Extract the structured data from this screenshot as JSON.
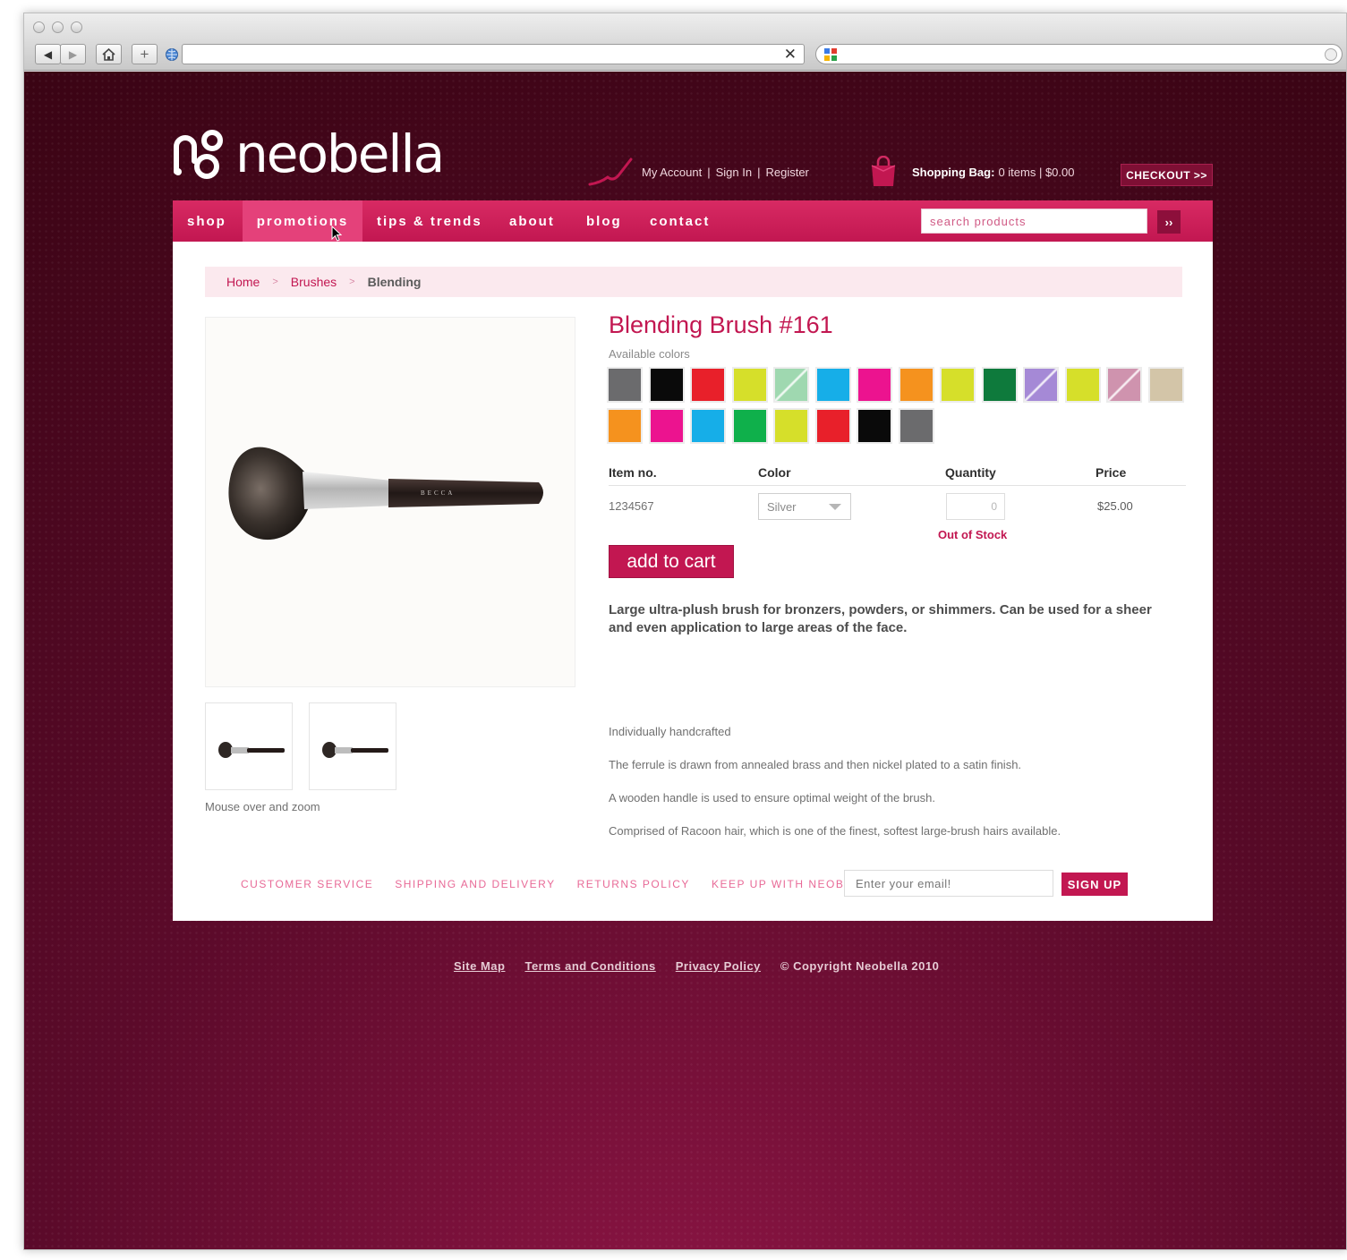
{
  "brand": {
    "name": "neobella"
  },
  "account": {
    "my_account": "My Account",
    "sign_in": "Sign In",
    "register": "Register",
    "separator": "|"
  },
  "bag": {
    "label": "Shopping Bag:",
    "status": "0 items | $0.00",
    "checkout": "CHECKOUT >>"
  },
  "nav": {
    "items": [
      {
        "label": "shop"
      },
      {
        "label": "promotions",
        "active": true
      },
      {
        "label": "tips & trends"
      },
      {
        "label": "about"
      },
      {
        "label": "blog"
      },
      {
        "label": "contact"
      }
    ],
    "search_placeholder": "search products",
    "search_go": "››"
  },
  "breadcrumb": {
    "items": [
      "Home",
      "Brushes",
      "Blending"
    ],
    "separator": ">"
  },
  "product": {
    "title": "Blending Brush #161",
    "colors_label": "Available colors",
    "swatches": [
      {
        "color": "#6b6b6d"
      },
      {
        "color": "#0a0a0a"
      },
      {
        "color": "#e8202a"
      },
      {
        "color": "#d6df2a"
      },
      {
        "color": "#9fd8b0",
        "striped": true
      },
      {
        "color": "#16aee8"
      },
      {
        "color": "#ec138f"
      },
      {
        "color": "#f5921e"
      },
      {
        "color": "#d6df2a"
      },
      {
        "color": "#0e7a3c"
      },
      {
        "color": "#a589d6",
        "striped": true
      },
      {
        "color": "#d6df2a"
      },
      {
        "color": "#cf93ae",
        "striped": true
      },
      {
        "color": "#d3c5a8"
      },
      {
        "color": "#f5921e"
      },
      {
        "color": "#ec138f"
      },
      {
        "color": "#16aee8"
      },
      {
        "color": "#0fb04b"
      },
      {
        "color": "#d6df2a"
      },
      {
        "color": "#e8202a"
      },
      {
        "color": "#0a0a0a"
      },
      {
        "color": "#6b6b6d"
      }
    ],
    "table": {
      "headers": [
        "Item no.",
        "Color",
        "Quantity",
        "Price"
      ],
      "item_no": "1234567",
      "color_value": "Silver",
      "quantity": "0",
      "price": "$25.00",
      "stock_status": "Out of Stock"
    },
    "add_to_cart": "add to cart",
    "description": "Large ultra-plush brush for bronzers, powders, or shimmers. Can be used for a sheer and even application to large areas of the face.",
    "details": [
      "Individually handcrafted",
      "The ferrule is drawn from annealed brass and then nickel plated to a satin finish.",
      "A wooden handle is used to ensure optimal weight of the brush.",
      "Comprised of Racoon hair, which is one of the finest, softest large-brush hairs available."
    ],
    "image_brand": "BECCA",
    "zoom_hint": "Mouse over and zoom"
  },
  "footer": {
    "links": [
      "CUSTOMER SERVICE",
      "SHIPPING AND DELIVERY",
      "RETURNS POLICY",
      "KEEP UP WITH NEOBELLA"
    ],
    "email_placeholder": "Enter your email!",
    "signup": "SIGN UP"
  },
  "legal": {
    "links": [
      "Site Map",
      "Terms and Conditions",
      "Privacy Policy"
    ],
    "copyright": "© Copyright Neobella 2010"
  },
  "colors": {
    "accent": "#c21751",
    "background_dark": "#3a0414",
    "nav_active": "#e4417a"
  }
}
